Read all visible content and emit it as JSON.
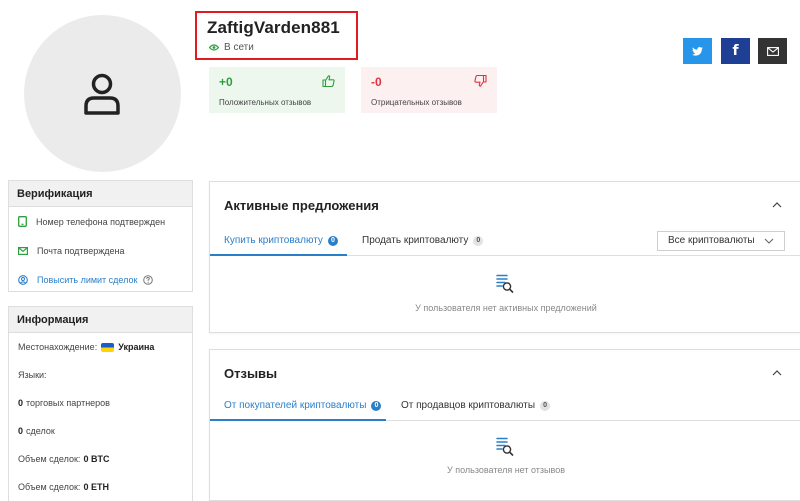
{
  "profile": {
    "username": "ZaftigVarden881",
    "status": "В сети"
  },
  "feedback": {
    "positive_value": "+0",
    "positive_label": "Положительных отзывов",
    "negative_value": "-0",
    "negative_label": "Отрицательных отзывов"
  },
  "social": [
    "twitter-icon",
    "facebook-icon",
    "mail-icon"
  ],
  "verification": {
    "title": "Верификация",
    "items": [
      {
        "label": "Номер телефона подтвержден",
        "icon": "phone-icon"
      },
      {
        "label": "Почта подтверждена",
        "icon": "mail-icon"
      },
      {
        "label": "Повысить лимит сделок",
        "icon": "user-circle-icon"
      }
    ]
  },
  "info": {
    "title": "Информация",
    "location_label": "Местонахождение:",
    "location_value": "Украина",
    "languages_label": "Языки:",
    "partners_count": "0",
    "partners_label": "торговых партнеров",
    "deals_count": "0",
    "deals_label": "сделок",
    "volume_btc_label": "Объем сделок:",
    "volume_btc_value": "0 BTC",
    "volume_eth_label": "Объем сделок:",
    "volume_eth_value": "0 ETH"
  },
  "offers": {
    "title": "Активные предложения",
    "tabs": [
      {
        "label": "Купить криптовалюту",
        "count": "0"
      },
      {
        "label": "Продать криптовалюту",
        "count": "0"
      }
    ],
    "filter": "Все криптовалюты",
    "empty": "У пользователя нет активных предложений"
  },
  "reviews": {
    "title": "Отзывы",
    "tabs": [
      {
        "label": "От покупателей криптовалюты",
        "count": "0"
      },
      {
        "label": "От продавцов криптовалюты",
        "count": "0"
      }
    ],
    "empty": "У пользователя нет отзывов"
  },
  "colors": {
    "accent": "#2a7fc9",
    "positive": "#2e9e3e",
    "negative": "#e0323f",
    "twitter": "#2795e9",
    "facebook": "#1e3f94",
    "highlight": "#e01b22"
  }
}
